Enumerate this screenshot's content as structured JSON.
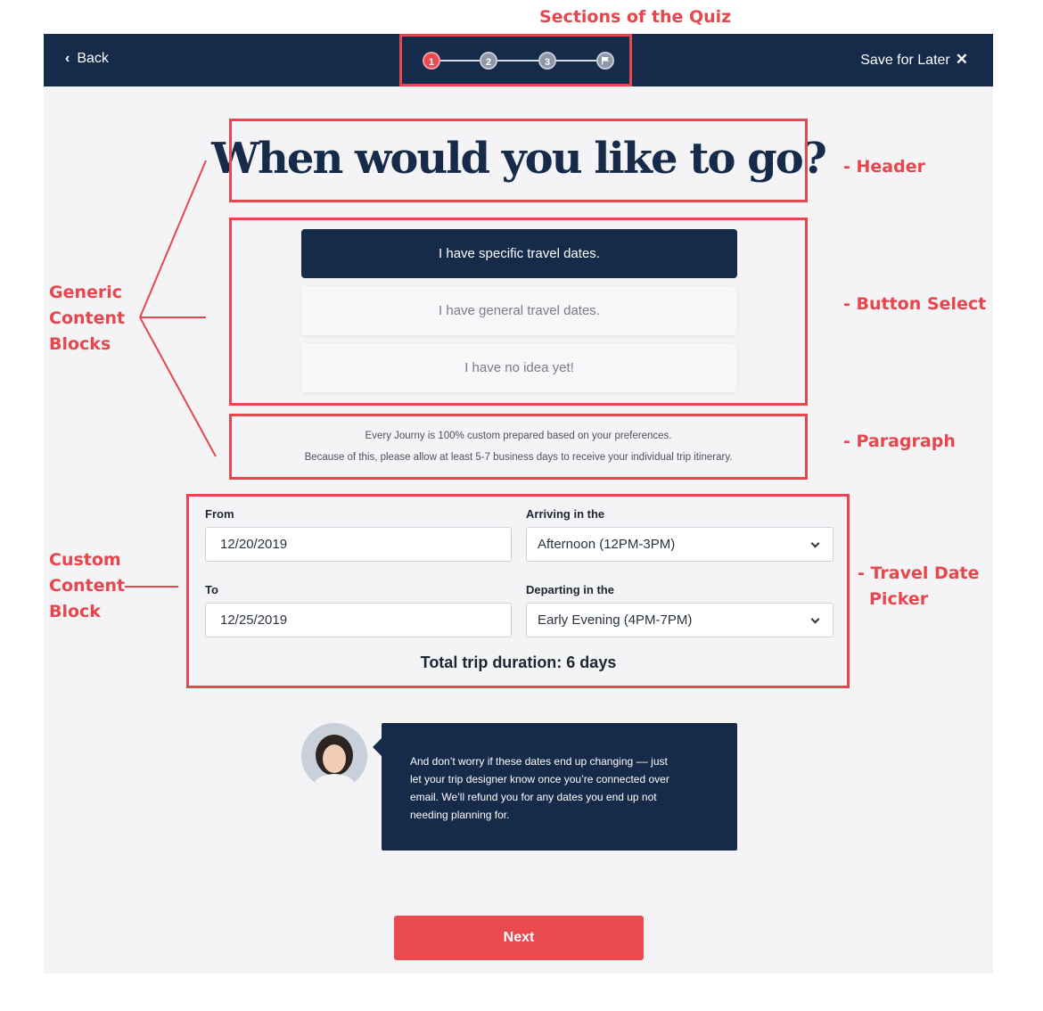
{
  "annotations": {
    "sections_of_quiz": "Sections of the Quiz",
    "generic_blocks": [
      "Generic",
      "Content",
      "Blocks"
    ],
    "custom_block": [
      "Custom",
      "Content",
      "Block"
    ],
    "header": "- Header",
    "button_select": "- Button Select",
    "paragraph": "- Paragraph",
    "travel_date_picker": [
      "- Travel Date",
      "Picker"
    ]
  },
  "topbar": {
    "back_label": "Back",
    "save_label": "Save for Later",
    "steps": [
      "1",
      "2",
      "3"
    ],
    "final_step_icon": "flag-icon",
    "active_step": 1
  },
  "main": {
    "headline": "When would you like to go?",
    "choices": [
      "I have specific travel dates.",
      "I have general travel dates.",
      "I have no idea yet!"
    ],
    "selected_choice": 0,
    "paragraph": [
      "Every Journy is 100% custom prepared based on your preferences.",
      "Because of this, please allow at least 5-7 business days to receive your individual trip itinerary."
    ]
  },
  "date_picker": {
    "from_label": "From",
    "from_value": "12/20/2019",
    "to_label": "To",
    "to_value": "12/25/2019",
    "arriving_label": "Arriving in the",
    "arriving_value": "Afternoon (12PM-3PM)",
    "departing_label": "Departing in the",
    "departing_value": "Early Evening (4PM-7PM)",
    "total_label": "Total trip duration: 6 days"
  },
  "designer": {
    "message_lines": [
      "And don’t worry if these dates end up changing –– just",
      "let your trip designer know once you’re connected over",
      "email. We’ll refund you for any dates you end up not",
      "needing planning for."
    ]
  },
  "next_label": "Next",
  "colors": {
    "navy": "#162a4a",
    "accent_red": "#ea494f",
    "annotation_red": "#e8464d",
    "background": "#f4f4f6"
  }
}
